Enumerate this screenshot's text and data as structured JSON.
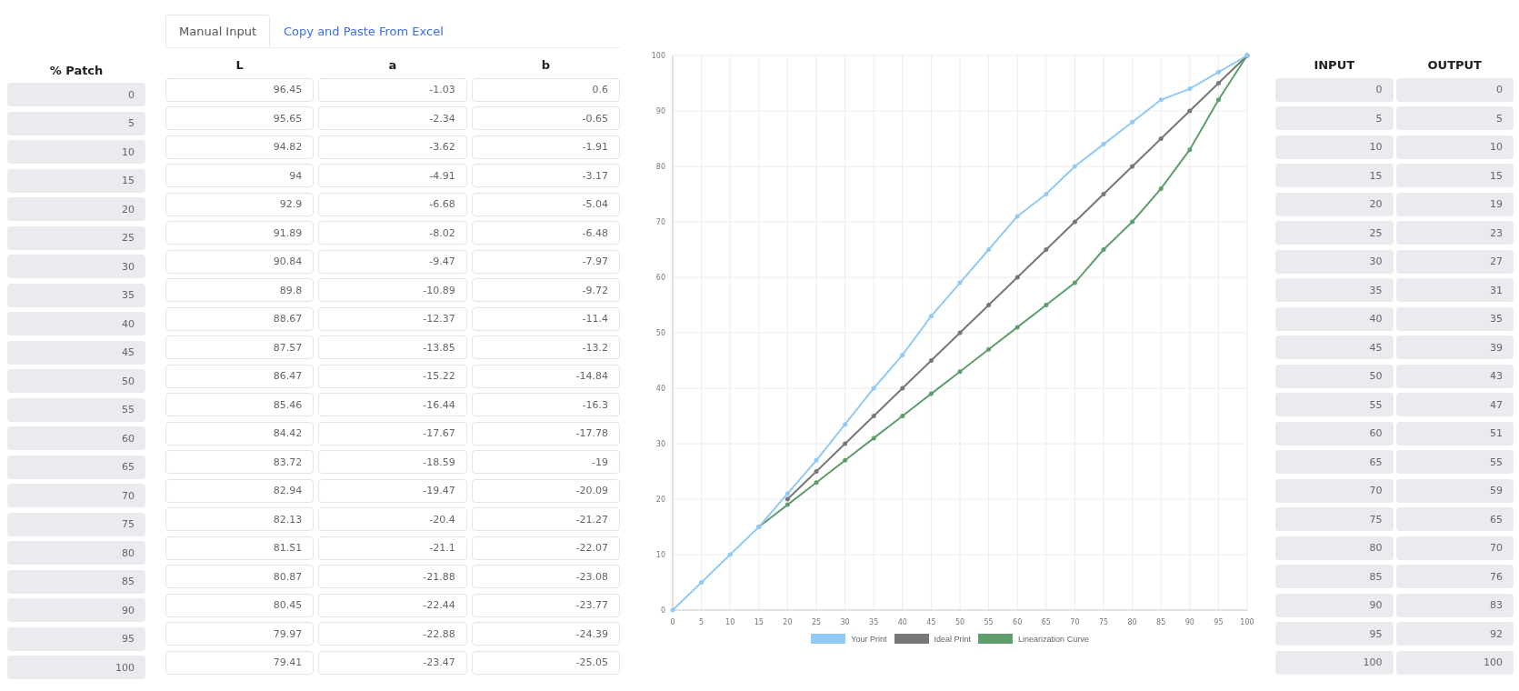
{
  "tabs": [
    {
      "label": "Manual Input",
      "selected": true
    },
    {
      "label": "Copy and Paste From Excel",
      "selected": false
    }
  ],
  "patch_column": {
    "heading": "% Patch",
    "values": [
      "0",
      "5",
      "10",
      "15",
      "20",
      "25",
      "30",
      "35",
      "40",
      "45",
      "50",
      "55",
      "60",
      "65",
      "70",
      "75",
      "80",
      "85",
      "90",
      "95",
      "100"
    ]
  },
  "lab_table": {
    "columns": [
      "L",
      "a",
      "b"
    ],
    "rows": [
      [
        "96.45",
        "-1.03",
        "0.6"
      ],
      [
        "95.65",
        "-2.34",
        "-0.65"
      ],
      [
        "94.82",
        "-3.62",
        "-1.91"
      ],
      [
        "94",
        "-4.91",
        "-3.17"
      ],
      [
        "92.9",
        "-6.68",
        "-5.04"
      ],
      [
        "91.89",
        "-8.02",
        "-6.48"
      ],
      [
        "90.84",
        "-9.47",
        "-7.97"
      ],
      [
        "89.8",
        "-10.89",
        "-9.72"
      ],
      [
        "88.67",
        "-12.37",
        "-11.4"
      ],
      [
        "87.57",
        "-13.85",
        "-13.2"
      ],
      [
        "86.47",
        "-15.22",
        "-14.84"
      ],
      [
        "85.46",
        "-16.44",
        "-16.3"
      ],
      [
        "84.42",
        "-17.67",
        "-17.78"
      ],
      [
        "83.72",
        "-18.59",
        "-19"
      ],
      [
        "82.94",
        "-19.47",
        "-20.09"
      ],
      [
        "82.13",
        "-20.4",
        "-21.27"
      ],
      [
        "81.51",
        "-21.1",
        "-22.07"
      ],
      [
        "80.87",
        "-21.88",
        "-23.08"
      ],
      [
        "80.45",
        "-22.44",
        "-23.77"
      ],
      [
        "79.97",
        "-22.88",
        "-24.39"
      ],
      [
        "79.41",
        "-23.47",
        "-25.05"
      ]
    ]
  },
  "chart": {
    "chart_data": {
      "type": "line",
      "x": [
        0,
        5,
        10,
        15,
        20,
        25,
        30,
        35,
        40,
        45,
        50,
        55,
        60,
        65,
        70,
        75,
        80,
        85,
        90,
        95,
        100
      ],
      "xlim": [
        0,
        100
      ],
      "ylim": [
        0,
        100
      ],
      "grid": true,
      "legend": true,
      "xticks": [
        0,
        5,
        10,
        15,
        20,
        25,
        30,
        35,
        40,
        45,
        50,
        55,
        60,
        65,
        70,
        75,
        80,
        85,
        90,
        95,
        100
      ],
      "yticks": [
        0,
        10,
        20,
        30,
        40,
        50,
        60,
        70,
        80,
        90,
        100
      ],
      "series": [
        {
          "name": "Your Print",
          "color": "#90caf9",
          "values": [
            0,
            5,
            10,
            15,
            21,
            27,
            33.5,
            40,
            46,
            53,
            59,
            65,
            71,
            75,
            80,
            84,
            88,
            92,
            94,
            97,
            100
          ]
        },
        {
          "name": "Ideal Print",
          "color": "#777777",
          "values": [
            null,
            null,
            null,
            null,
            20,
            25,
            30,
            35,
            40,
            45,
            50,
            55,
            60,
            65,
            70,
            75,
            80,
            85,
            90,
            95,
            100
          ]
        },
        {
          "name": "Linearization Curve",
          "color": "#5e9e6c",
          "values": [
            null,
            null,
            null,
            15,
            19,
            23,
            27,
            31,
            35,
            39,
            43,
            47,
            51,
            55,
            59,
            65,
            70,
            76,
            83,
            92,
            100
          ]
        }
      ]
    }
  },
  "curve_table": {
    "columns": [
      "INPUT",
      "OUTPUT"
    ],
    "rows": [
      [
        "0",
        "0"
      ],
      [
        "5",
        "5"
      ],
      [
        "10",
        "10"
      ],
      [
        "15",
        "15"
      ],
      [
        "20",
        "19"
      ],
      [
        "25",
        "23"
      ],
      [
        "30",
        "27"
      ],
      [
        "35",
        "31"
      ],
      [
        "40",
        "35"
      ],
      [
        "45",
        "39"
      ],
      [
        "50",
        "43"
      ],
      [
        "55",
        "47"
      ],
      [
        "60",
        "51"
      ],
      [
        "65",
        "55"
      ],
      [
        "70",
        "59"
      ],
      [
        "75",
        "65"
      ],
      [
        "80",
        "70"
      ],
      [
        "85",
        "76"
      ],
      [
        "90",
        "83"
      ],
      [
        "95",
        "92"
      ],
      [
        "100",
        "100"
      ]
    ]
  }
}
